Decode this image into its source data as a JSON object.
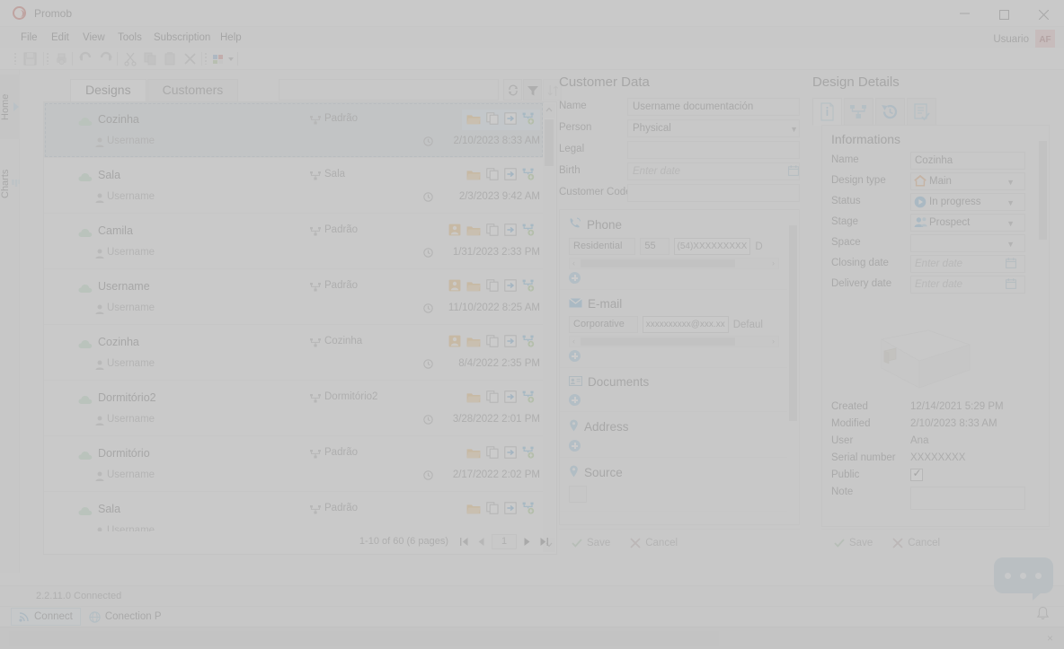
{
  "window": {
    "app_title": "Promob",
    "minimize_label": "Minimize",
    "maximize_label": "Maximize",
    "close_label": "Close"
  },
  "menubar": {
    "items": [
      {
        "label": "File"
      },
      {
        "label": "Edit"
      },
      {
        "label": "View"
      },
      {
        "label": "Tools"
      },
      {
        "label": "Subscription"
      },
      {
        "label": "Help"
      }
    ]
  },
  "user": {
    "name": "Usuario",
    "initials": "AF"
  },
  "toolbar": {
    "icons": [
      {
        "name": "save-icon"
      },
      {
        "name": "print-icon"
      },
      {
        "name": "undo-icon"
      },
      {
        "name": "redo-icon"
      },
      {
        "name": "cut-icon"
      },
      {
        "name": "copy-icon"
      },
      {
        "name": "paste-icon"
      },
      {
        "name": "delete-icon"
      },
      {
        "name": "layout-color-icon"
      }
    ]
  },
  "vertical_tabs": [
    {
      "label": "Home",
      "icon": "home-arrow-icon",
      "active": true
    },
    {
      "label": "Charts",
      "icon": "bar-chart-icon",
      "active": false
    }
  ],
  "designs_panel": {
    "tabs": [
      {
        "label": "Designs",
        "active": true
      },
      {
        "label": "Customers",
        "active": false
      }
    ],
    "search": {
      "value": "",
      "placeholder": ""
    },
    "buttons": {
      "refresh": "refresh-icon",
      "filter": "filter-icon",
      "sort": "sort-icon"
    },
    "rows": [
      {
        "name": "Cozinha",
        "user": "Username",
        "type": "Padrão",
        "date": "2/10/2023 8:33 AM",
        "selected": true,
        "has_customer_icon": false
      },
      {
        "name": "Sala",
        "user": "Username",
        "type": "Sala",
        "date": "2/3/2023 9:42 AM",
        "selected": false,
        "has_customer_icon": false
      },
      {
        "name": "Camila",
        "user": "Username",
        "type": "Padrão",
        "date": "1/31/2023 2:33 PM",
        "selected": false,
        "has_customer_icon": true
      },
      {
        "name": "Username",
        "user": "Username",
        "type": "Padrão",
        "date": "11/10/2022 8:25 AM",
        "selected": false,
        "has_customer_icon": true
      },
      {
        "name": "Cozinha",
        "user": "Username",
        "type": "Cozinha",
        "date": "8/4/2022 2:35 PM",
        "selected": false,
        "has_customer_icon": true
      },
      {
        "name": "Dormitório2",
        "user": "Username",
        "type": "Dormitório2",
        "date": "3/28/2022 2:01 PM",
        "selected": false,
        "has_customer_icon": false
      },
      {
        "name": "Dormitório",
        "user": "Username",
        "type": "Padrão",
        "date": "2/17/2022 2:02 PM",
        "selected": false,
        "has_customer_icon": false
      },
      {
        "name": "Sala",
        "user": "Username",
        "type": "Padrão",
        "date": "",
        "selected": false,
        "has_customer_icon": false
      }
    ],
    "row_actions": [
      {
        "name": "customer-icon"
      },
      {
        "name": "open-folder-icon"
      },
      {
        "name": "copy-icon"
      },
      {
        "name": "export-icon"
      },
      {
        "name": "share-cloud-icon"
      }
    ],
    "pager": {
      "summary": "1-10 of 60 (6 pages)",
      "current_page": "1",
      "first_label": "First page",
      "prev_label": "Previous page",
      "next_label": "Next page",
      "last_label": "Last page"
    }
  },
  "customer_data": {
    "title": "Customer Data",
    "fields": [
      {
        "label": "Name",
        "value": "Username documentación",
        "type": "text",
        "placeholder": ""
      },
      {
        "label": "Person",
        "value": "Physical",
        "type": "select",
        "placeholder": ""
      },
      {
        "label": "Legal",
        "value": "",
        "type": "text",
        "placeholder": ""
      },
      {
        "label": "Birth",
        "value": "",
        "type": "date",
        "placeholder": "Enter date"
      },
      {
        "label": "Customer Code",
        "value": "",
        "type": "text",
        "placeholder": ""
      }
    ],
    "sections": [
      {
        "title": "Phone",
        "icon": "phone-icon",
        "controls": [
          {
            "kind": "select",
            "value": "Residential"
          },
          {
            "kind": "select",
            "value": "55"
          },
          {
            "kind": "input",
            "value": "(54)XXXXXXXXX"
          },
          {
            "kind": "text",
            "value": "D"
          }
        ]
      },
      {
        "title": "E-mail",
        "icon": "mail-icon",
        "controls": [
          {
            "kind": "select",
            "value": "Corporative"
          },
          {
            "kind": "input",
            "value": "xxxxxxxxxx@xxx.xx"
          },
          {
            "kind": "text",
            "value": "Defaul"
          }
        ]
      },
      {
        "title": "Documents",
        "icon": "id-card-icon",
        "controls": []
      },
      {
        "title": "Address",
        "icon": "pin-icon",
        "controls": []
      },
      {
        "title": "Source",
        "icon": "pin-icon",
        "controls": [
          {
            "kind": "select",
            "value": ""
          }
        ]
      }
    ],
    "add_label": "Add",
    "save_label": "Save",
    "cancel_label": "Cancel"
  },
  "design_details": {
    "title": "Design Details",
    "tabs": [
      {
        "name": "info-tab",
        "icon": "info-document-icon",
        "active": true
      },
      {
        "name": "structure-tab",
        "icon": "hierarchy-icon",
        "active": false
      },
      {
        "name": "history-tab",
        "icon": "history-revert-icon",
        "active": false
      },
      {
        "name": "checklist-tab",
        "icon": "checklist-icon",
        "active": false
      }
    ],
    "section_title": "Informations",
    "fields": [
      {
        "label": "Name",
        "value": "Cozinha",
        "type": "text",
        "icon": "",
        "placeholder": ""
      },
      {
        "label": "Design type",
        "value": "Main",
        "type": "select",
        "icon": "house-icon",
        "placeholder": ""
      },
      {
        "label": "Status",
        "value": "In progress",
        "type": "select",
        "icon": "play-icon",
        "placeholder": ""
      },
      {
        "label": "Stage",
        "value": "Prospect",
        "type": "select",
        "icon": "people-icon",
        "placeholder": ""
      },
      {
        "label": "Space",
        "value": "",
        "type": "select",
        "icon": "",
        "placeholder": ""
      },
      {
        "label": "Closing date",
        "value": "",
        "type": "date",
        "icon": "",
        "placeholder": "Enter date"
      },
      {
        "label": "Delivery date",
        "value": "",
        "type": "date",
        "icon": "",
        "placeholder": "Enter date"
      }
    ],
    "preview_name": "design-3d-preview",
    "meta": [
      {
        "label": "Created",
        "value": "12/14/2021 5:29 PM",
        "type": "text"
      },
      {
        "label": "Modified",
        "value": "2/10/2023 8:33 AM",
        "type": "text"
      },
      {
        "label": "User",
        "value": "Ana",
        "type": "text"
      },
      {
        "label": "Serial number",
        "value": "XXXXXXXX",
        "type": "text"
      },
      {
        "label": "Public",
        "value": "",
        "type": "checkbox"
      },
      {
        "label": "Note",
        "value": "",
        "type": "textarea"
      }
    ],
    "save_label": "Save",
    "cancel_label": "Cancel"
  },
  "statusbar": {
    "version_status": "2.2.11.0 Connected",
    "tabs": [
      {
        "label": "Connect",
        "icon": "rss-icon",
        "active": true
      },
      {
        "label": "Conection P",
        "icon": "globe-icon",
        "active": false
      }
    ]
  },
  "chat": {
    "name": "chat-bubble",
    "dots": 3
  },
  "notifications": {
    "name": "bell-icon"
  },
  "colors": {
    "accent_blue": "#3f9ad6",
    "folder_orange": "#e8a33d",
    "cloud_green": "#a8d5b5",
    "selected_row": "#cfd9e0",
    "avatar_bg": "#e8b6b6"
  }
}
